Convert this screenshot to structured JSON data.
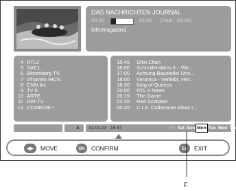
{
  "info": {
    "title": "DAS NACHRICHTEN JOURNAL",
    "time_start": "00:25",
    "time_end": "01:00",
    "total": "(Total : 00:35)",
    "genre": "InformagazinS",
    "progress": 0.22
  },
  "channels": [
    {
      "num": "4",
      "name": "RTL2"
    },
    {
      "num": "5",
      "name": "SAT.1"
    },
    {
      "num": "6",
      "name": "Bloomberg TV."
    },
    {
      "num": "7",
      "name": "dTravelo IHCN."
    },
    {
      "num": "8",
      "name": "CNN Int."
    },
    {
      "num": "9",
      "name": "TV 5"
    },
    {
      "num": "10",
      "name": "ARTE"
    },
    {
      "num": "11",
      "name": "DW-TV"
    },
    {
      "num": "12",
      "name": "COMEDIE !"
    }
  ],
  "programs": [
    {
      "time": "15:45",
      "title": "Shin Chan"
    },
    {
      "time": "16:00",
      "title": "Schnulleralarm 3! - Wir..."
    },
    {
      "time": "17:00",
      "title": "Achtung Baustelle! Uns..."
    },
    {
      "time": "18:00",
      "title": "Veronica - Verliebt, verl..."
    },
    {
      "time": "18:30",
      "title": "King of Queens"
    },
    {
      "time": "20:00",
      "title": "RTL II News"
    },
    {
      "time": "20:15",
      "title": "The Game"
    },
    {
      "time": "22:35",
      "title": "Red Scorpion"
    },
    {
      "time": "00:35",
      "title": "C.I.A. Codename Alexa I..."
    }
  ],
  "status": {
    "letter": "A",
    "date": "31-01-03",
    "time": "15:47",
    "days": [
      "Fri",
      "Sat",
      "Sun",
      "Mon",
      "Tue",
      "Wed",
      "Thu"
    ],
    "selected_day": "Mon"
  },
  "nav": {
    "move_icon": "◀▶",
    "move_label": "MOVE",
    "ok_icon": "OK",
    "confirm_label": "CONFIRM",
    "exit_icon": "Ex",
    "exit_label": "EXIT"
  },
  "callout": {
    "label": "F"
  },
  "colors": {
    "panel": "#9c9c9c",
    "text": "#ffffff"
  }
}
